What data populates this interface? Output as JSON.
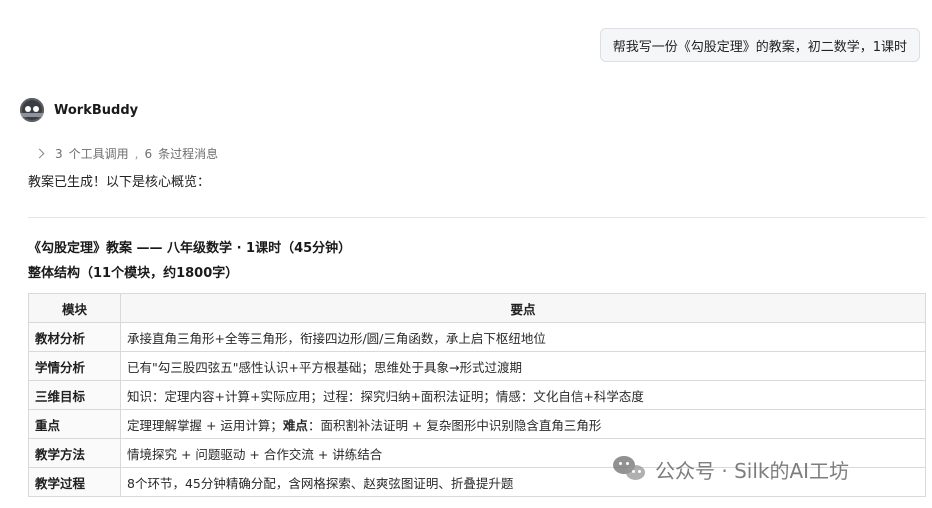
{
  "user_message": "帮我写一份《勾股定理》的教案，初二数学，1课时",
  "bot": {
    "name": "WorkBuddy",
    "avatar_icon": "robot-avatar-icon"
  },
  "tool_summary": {
    "tool_count": "3",
    "tool_label": "个工具调用",
    "separator": ",",
    "process_count": "6",
    "process_label": "条过程消息"
  },
  "done_text": "教案已生成！以下是核心概览：",
  "doc_title": "《勾股定理》教案 —— 八年级数学 · 1课时（45分钟）",
  "structure_title": "整体结构（11个模块，约1800字）",
  "table": {
    "headers": [
      "模块",
      "要点"
    ],
    "rows": [
      {
        "module": "教材分析",
        "points": "承接直角三角形+全等三角形，衔接四边形/圆/三角函数，承上启下枢纽地位"
      },
      {
        "module": "学情分析",
        "points": "已有\"勾三股四弦五\"感性认识+平方根基础；思维处于具象→形式过渡期"
      },
      {
        "module": "三维目标",
        "points": "知识：定理内容+计算+实际应用；过程：探究归纳+面积法证明；情感：文化自信+科学态度"
      },
      {
        "module": "重点",
        "points_pre": "定理理解掌握 + 运用计算；",
        "points_bold": "难点",
        "points_post": "：面积割补法证明 + 复杂图形中识别隐含直角三角形"
      },
      {
        "module": "教学方法",
        "points": "情境探究 + 问题驱动 + 合作交流 + 讲练结合"
      },
      {
        "module": "教学过程",
        "points": "8个环节，45分钟精确分配，含网格探索、赵爽弦图证明、折叠提升题"
      }
    ]
  },
  "watermark": {
    "text": "公众号 · Silk的AI工坊",
    "icon": "wechat-icon"
  }
}
